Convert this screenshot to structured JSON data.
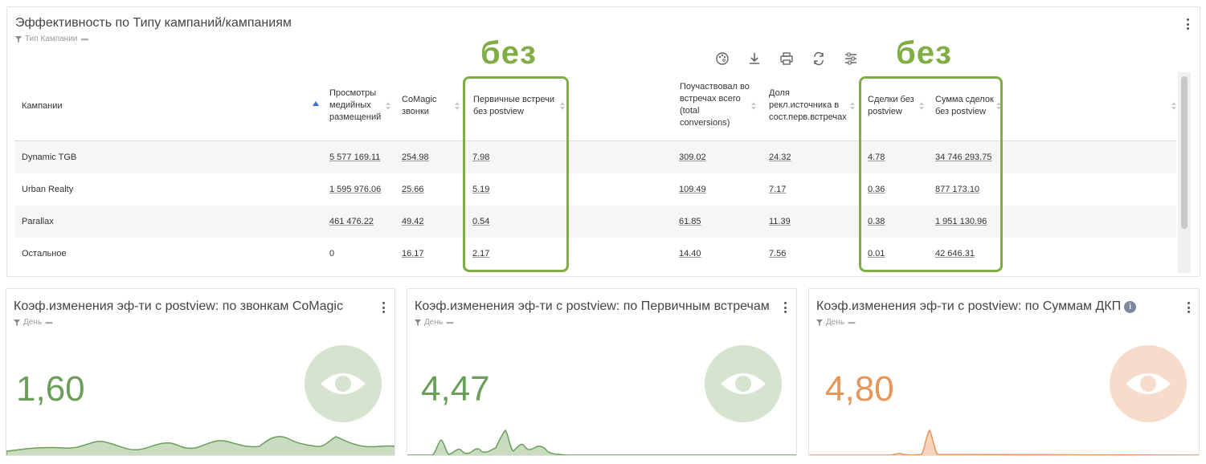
{
  "top_panel": {
    "title": "Эффективность по Типу кампаний/кампаниям",
    "filter_label": "Тип Кампании",
    "annotation_left": "без",
    "annotation_right": "без",
    "columns": [
      "Кампании",
      "Просмотры медийных размещений",
      "CoMagic звонки",
      "Первичные встречи без postview",
      "Поучаствовал во встречах всего (total conversions)",
      "Доля рекл.источника в сост.перв.встречах",
      "Сделки без postview",
      "Сумма сделок без postview"
    ],
    "col_lines": [
      [
        "Кампании"
      ],
      [
        "Просмотры",
        "медийных",
        "размещений"
      ],
      [
        "CoMagic",
        "звонки"
      ],
      [
        "Первичные встречи",
        "без postview"
      ],
      [
        "Поучаствовал во",
        "встречах всего",
        "(total",
        "conversions)"
      ],
      [
        "Доля",
        "рекл.источника в",
        "сост.перв.встречах"
      ],
      [
        "Сделки без",
        "postview"
      ],
      [
        "Сумма сделок",
        "без postview"
      ]
    ],
    "rows": [
      {
        "name": "Dynamic TGB",
        "views": "5 577 169.11",
        "calls": "254.98",
        "first_meetings": "7.98",
        "total_conv": "309.02",
        "share": "24.32",
        "deals": "4.78",
        "deal_sum": "34 746 293.75"
      },
      {
        "name": "Urban Realty",
        "views": "1 595 976.06",
        "calls": "25.66",
        "first_meetings": "5.19",
        "total_conv": "109.49",
        "share": "7.17",
        "deals": "0.36",
        "deal_sum": "877 173.10"
      },
      {
        "name": "Parallax",
        "views": "461 476.22",
        "calls": "49.42",
        "first_meetings": "0.54",
        "total_conv": "61.85",
        "share": "11.39",
        "deals": "0.38",
        "deal_sum": "1 951 130.96"
      },
      {
        "name": "Остальное",
        "views": "0",
        "calls": "16.17",
        "first_meetings": "2.17",
        "total_conv": "14.40",
        "share": "7.56",
        "deals": "0.01",
        "deal_sum": "42 646.31"
      }
    ],
    "toolbar_icons": [
      "palette-icon",
      "download-icon",
      "print-icon",
      "refresh-icon",
      "settings-icon"
    ]
  },
  "kpi_cards": [
    {
      "title": "Коэф.изменения эф-ти с postview: по звонкам CoMagic",
      "filter": "День",
      "value": "1,60",
      "color": "#6a9f5a",
      "fill": "#c9dcc1",
      "circle": "#d6e4cf"
    },
    {
      "title": "Коэф.изменения эф-ти с postview: по Первичным встречам",
      "filter": "День",
      "value": "4,47",
      "color": "#6a9f5a",
      "fill": "#c9dcc1",
      "circle": "#d6e4cf"
    },
    {
      "title": "Коэф.изменения эф-ти с postview: по Суммам ДКП",
      "filter": "День",
      "value": "4,80",
      "color": "#e8955a",
      "fill": "#f6d3bd",
      "circle": "#f7dccb"
    }
  ]
}
